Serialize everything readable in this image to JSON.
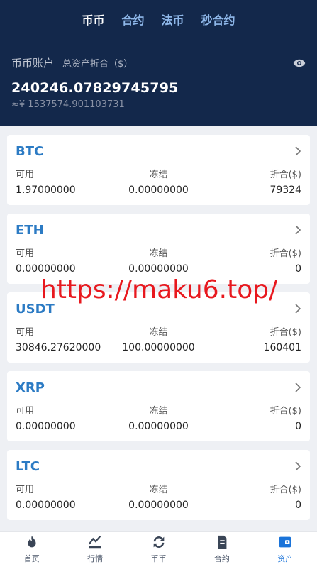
{
  "tabs": [
    {
      "label": "币币",
      "active": true
    },
    {
      "label": "合约",
      "active": false
    },
    {
      "label": "法币",
      "active": false
    },
    {
      "label": "秒合约",
      "active": false
    }
  ],
  "account": {
    "title": "币币账户",
    "subtitle": "总资产折合（$）",
    "balance": "240246.07829745795",
    "approx": "≈¥ 1537574.901103731"
  },
  "assets": [
    {
      "coin": "BTC",
      "available_label": "可用",
      "frozen_label": "冻结",
      "value_label": "折合($)",
      "available": "1.97000000",
      "frozen": "0.00000000",
      "value": "79324"
    },
    {
      "coin": "ETH",
      "available_label": "可用",
      "frozen_label": "冻结",
      "value_label": "折合($)",
      "available": "0.00000000",
      "frozen": "0.00000000",
      "value": "0"
    },
    {
      "coin": "USDT",
      "available_label": "可用",
      "frozen_label": "冻结",
      "value_label": "折合($)",
      "available": "30846.27620000",
      "frozen": "100.00000000",
      "value": "160401"
    },
    {
      "coin": "XRP",
      "available_label": "可用",
      "frozen_label": "冻结",
      "value_label": "折合($)",
      "available": "0.00000000",
      "frozen": "0.00000000",
      "value": "0"
    },
    {
      "coin": "LTC",
      "available_label": "可用",
      "frozen_label": "冻结",
      "value_label": "折合($)",
      "available": "0.00000000",
      "frozen": "0.00000000",
      "value": "0"
    }
  ],
  "watermark": "https://maku6.top/",
  "nav": [
    {
      "label": "首页",
      "icon": "home-icon"
    },
    {
      "label": "行情",
      "icon": "market-icon"
    },
    {
      "label": "币币",
      "icon": "exchange-icon"
    },
    {
      "label": "合约",
      "icon": "contract-icon"
    },
    {
      "label": "资产",
      "icon": "wallet-icon",
      "active": true
    }
  ],
  "colors": {
    "header_bg": "#13284b",
    "coin_blue": "#2c7bc4",
    "active_nav": "#1a73d9",
    "watermark": "#e8181e"
  }
}
